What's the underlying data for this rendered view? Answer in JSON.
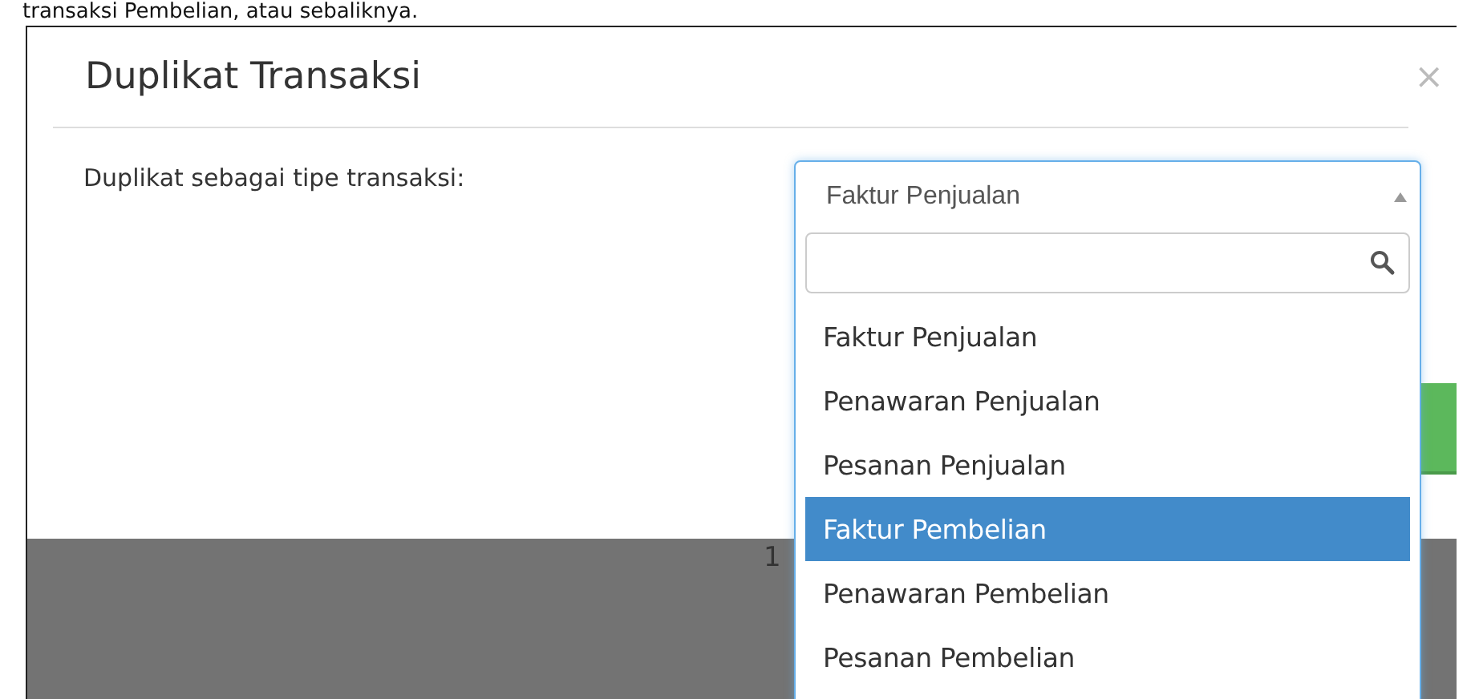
{
  "intro_text": "transaksi Pembelian, atau sebaliknya.",
  "dialog": {
    "title": "Duplikat Transaksi",
    "close": "×",
    "field_label": "Duplikat sebagai tipe transaksi:",
    "select": {
      "value": "Faktur Penjualan",
      "expanded": true,
      "options": [
        {
          "label": "Faktur Penjualan",
          "highlighted": false
        },
        {
          "label": "Penawaran Penjualan",
          "highlighted": false
        },
        {
          "label": "Pesanan Penjualan",
          "highlighted": false
        },
        {
          "label": "Faktur Pembelian",
          "highlighted": true
        },
        {
          "label": "Penawaran Pembelian",
          "highlighted": false
        },
        {
          "label": "Pesanan Pembelian",
          "highlighted": false
        }
      ]
    }
  },
  "background_text": "1"
}
